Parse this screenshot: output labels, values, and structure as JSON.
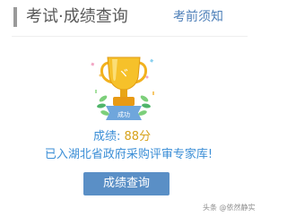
{
  "header": {
    "title": "考试·成绩查询",
    "notice_link": "考前须知"
  },
  "result": {
    "trophy_ribbon_text": "成功",
    "score_label": "成绩:",
    "score_value": "88分",
    "status_text": "已入湖北省政府采购评审专家库!"
  },
  "actions": {
    "query_button": "成绩查询"
  },
  "watermark": {
    "text": "头条 @依然静实"
  },
  "colors": {
    "accent_blue": "#3b8ed6",
    "gold": "#d7a21a",
    "button_blue": "#5a8fc6",
    "link_blue": "#4d7fb8"
  }
}
